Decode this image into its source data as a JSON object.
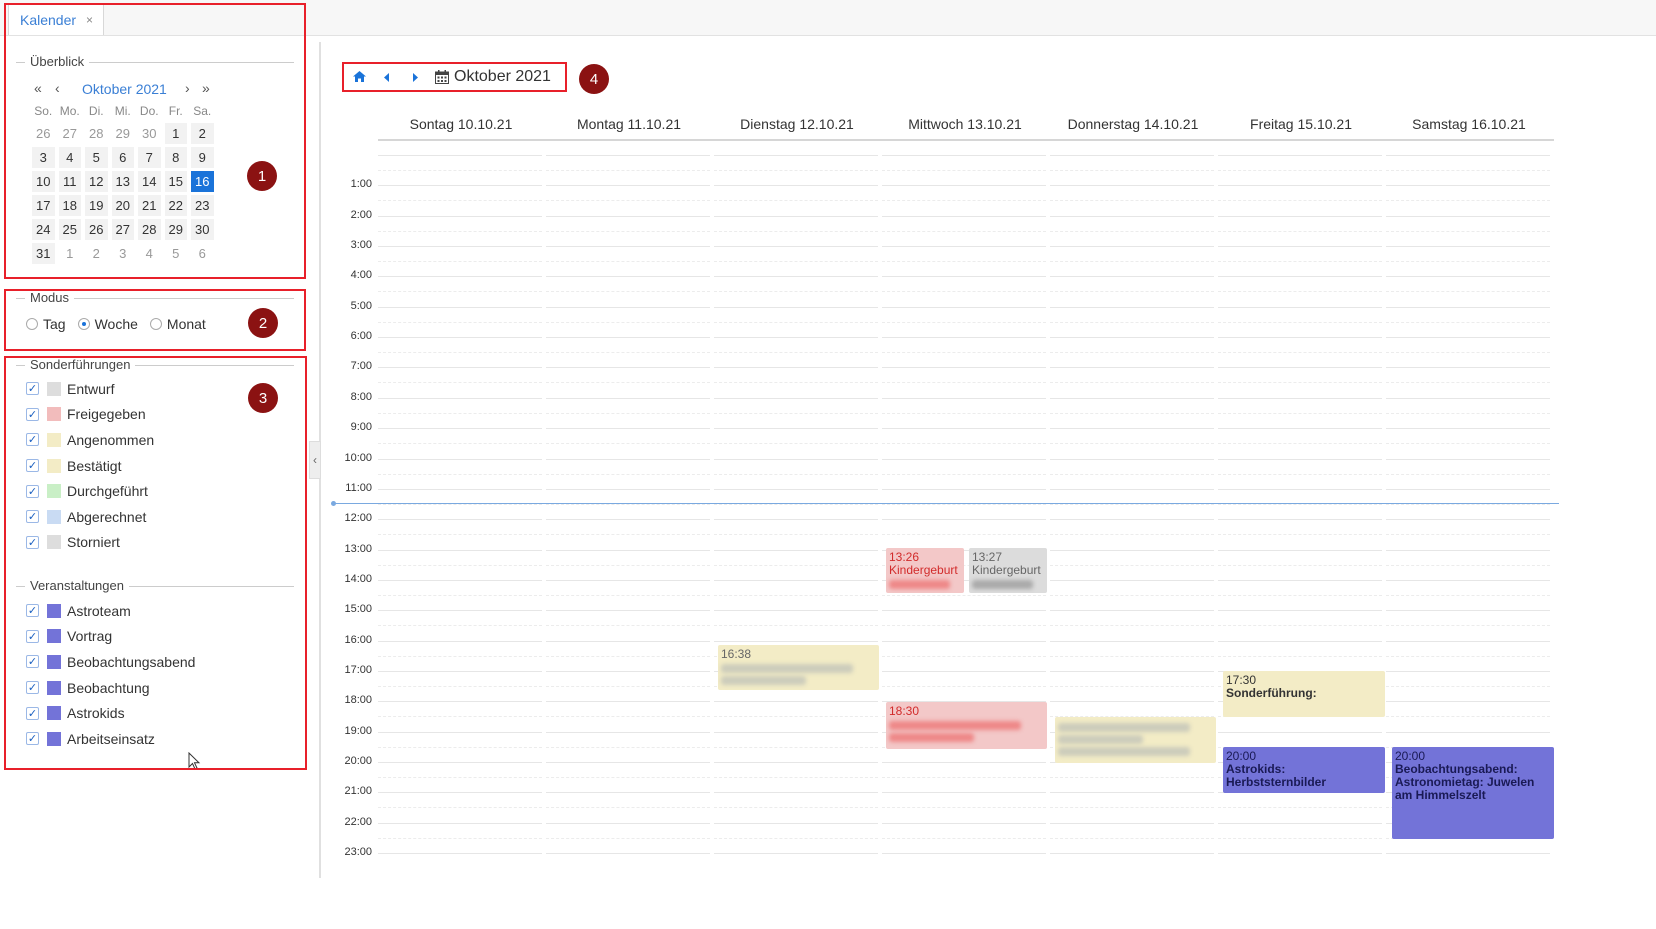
{
  "tab": {
    "label": "Kalender",
    "close": "×"
  },
  "overview": {
    "legend": "Überblick",
    "month_title": "Oktober 2021",
    "weekdays": [
      "So.",
      "Mo.",
      "Di.",
      "Mi.",
      "Do.",
      "Fr.",
      "Sa."
    ],
    "weeks": [
      [
        {
          "d": "26",
          "o": 1
        },
        {
          "d": "27",
          "o": 1
        },
        {
          "d": "28",
          "o": 1
        },
        {
          "d": "29",
          "o": 1
        },
        {
          "d": "30",
          "o": 1
        },
        {
          "d": "1"
        },
        {
          "d": "2"
        }
      ],
      [
        {
          "d": "3"
        },
        {
          "d": "4"
        },
        {
          "d": "5"
        },
        {
          "d": "6"
        },
        {
          "d": "7"
        },
        {
          "d": "8"
        },
        {
          "d": "9"
        }
      ],
      [
        {
          "d": "10"
        },
        {
          "d": "11"
        },
        {
          "d": "12"
        },
        {
          "d": "13"
        },
        {
          "d": "14"
        },
        {
          "d": "15"
        },
        {
          "d": "16",
          "t": 1
        }
      ],
      [
        {
          "d": "17"
        },
        {
          "d": "18"
        },
        {
          "d": "19"
        },
        {
          "d": "20"
        },
        {
          "d": "21"
        },
        {
          "d": "22"
        },
        {
          "d": "23"
        }
      ],
      [
        {
          "d": "24"
        },
        {
          "d": "25"
        },
        {
          "d": "26"
        },
        {
          "d": "27"
        },
        {
          "d": "28"
        },
        {
          "d": "29"
        },
        {
          "d": "30"
        }
      ],
      [
        {
          "d": "31"
        },
        {
          "d": "1",
          "o": 1
        },
        {
          "d": "2",
          "o": 1
        },
        {
          "d": "3",
          "o": 1
        },
        {
          "d": "4",
          "o": 1
        },
        {
          "d": "5",
          "o": 1
        },
        {
          "d": "6",
          "o": 1
        }
      ]
    ]
  },
  "mode": {
    "legend": "Modus",
    "options": [
      {
        "label": "Tag",
        "checked": false
      },
      {
        "label": "Woche",
        "checked": true
      },
      {
        "label": "Monat",
        "checked": false
      }
    ]
  },
  "special_tours": {
    "legend": "Sonderführungen",
    "items": [
      {
        "label": "Entwurf",
        "color": "#dddddd"
      },
      {
        "label": "Freigegeben",
        "color": "#f2bcbc"
      },
      {
        "label": "Angenommen",
        "color": "#f3ecc6"
      },
      {
        "label": "Bestätigt",
        "color": "#f3ecc6"
      },
      {
        "label": "Durchgeführt",
        "color": "#c9efc6"
      },
      {
        "label": "Abgerechnet",
        "color": "#c9dbf3"
      },
      {
        "label": "Storniert",
        "color": "#dddddd"
      }
    ]
  },
  "events_filter": {
    "legend": "Veranstaltungen",
    "items": [
      {
        "label": "Astroteam",
        "color": "#7373d8"
      },
      {
        "label": "Vortrag",
        "color": "#7373d8"
      },
      {
        "label": "Beobachtungsabend",
        "color": "#7373d8"
      },
      {
        "label": "Beobachtung",
        "color": "#7373d8"
      },
      {
        "label": "Astrokids",
        "color": "#7373d8"
      },
      {
        "label": "Arbeitseinsatz",
        "color": "#7373d8"
      }
    ]
  },
  "markers": [
    "1",
    "2",
    "3",
    "4"
  ],
  "toolbar": {
    "title": "Oktober 2021",
    "home_icon": "home-icon",
    "prev_icon": "caret-left-icon",
    "next_icon": "caret-right-icon",
    "calendar_icon": "calendar-icon"
  },
  "days": [
    "Sontag 10.10.21",
    "Montag 11.10.21",
    "Dienstag 12.10.21",
    "Mittwoch 13.10.21",
    "Donnerstag 14.10.21",
    "Freitag 15.10.21",
    "Samstag 16.10.21"
  ],
  "hours": [
    "1:00",
    "2:00",
    "3:00",
    "4:00",
    "5:00",
    "6:00",
    "7:00",
    "8:00",
    "9:00",
    "10:00",
    "11:00",
    "12:00",
    "13:00",
    "14:00",
    "15:00",
    "16:00",
    "17:00",
    "18:00",
    "19:00",
    "20:00",
    "21:00",
    "22:00",
    "23:00"
  ],
  "events": [
    {
      "day": 3,
      "start": "13:26",
      "title": "Kindergeburt",
      "bg": "#f3c8c8",
      "fg": "#d22b2b",
      "blur": [
        "#e88"
      ],
      "half": "left"
    },
    {
      "day": 3,
      "start": "13:27",
      "title": "Kindergeburt",
      "bg": "#dcdcdc",
      "fg": "#666",
      "blur": [
        "#aaa"
      ],
      "half": "right"
    },
    {
      "day": 2,
      "start": "16:38",
      "title": "",
      "bg": "#f3ecc6",
      "fg": "#666",
      "blur": [
        "#ccb",
        "#ccb"
      ]
    },
    {
      "day": 3,
      "start": "18:30",
      "title": "",
      "bg": "#f3c8c8",
      "fg": "#d22b2b",
      "blur": [
        "#e88",
        "#e88"
      ]
    },
    {
      "day": 4,
      "start": "",
      "title": "",
      "bg": "#f3ecc6",
      "fg": "#666",
      "blur": [
        "#ccb",
        "#ccb",
        "#ccb"
      ]
    },
    {
      "day": 5,
      "start": "17:30",
      "title": "Sonderführung:",
      "bg": "#f3ecc6",
      "fg": "#333",
      "blur": []
    },
    {
      "day": 5,
      "start": "20:00",
      "title": "Astrokids: Herbststernbilder",
      "bg": "#7373d8",
      "fg": "#1a1a55",
      "blur": []
    },
    {
      "day": 6,
      "start": "20:00",
      "title": "Beobachtungsabend: Astronomietag: Juwelen am Himmelszelt",
      "bg": "#7373d8",
      "fg": "#1a1a55",
      "blur": []
    }
  ]
}
